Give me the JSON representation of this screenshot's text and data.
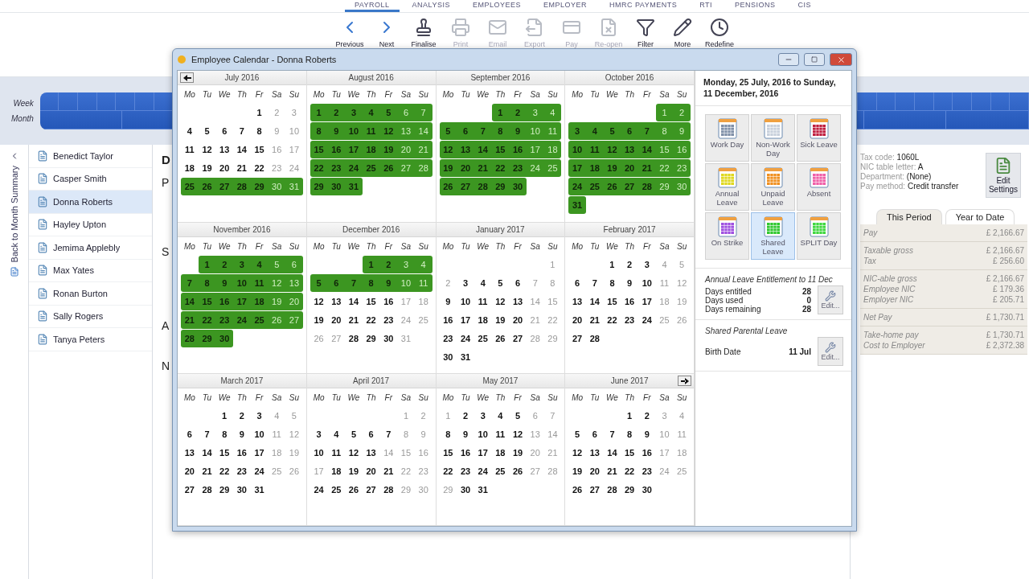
{
  "nav_tabs": [
    {
      "label": "PAYROLL",
      "selected": true
    },
    {
      "label": "ANALYSIS",
      "selected": false
    },
    {
      "label": "EMPLOYEES",
      "selected": false
    },
    {
      "label": "EMPLOYER",
      "selected": false
    },
    {
      "label": "HMRC PAYMENTS",
      "selected": false
    },
    {
      "label": "RTI",
      "selected": false
    },
    {
      "label": "PENSIONS",
      "selected": false
    },
    {
      "label": "CIS",
      "selected": false
    }
  ],
  "toolbar": [
    {
      "label": "Previous",
      "disabled": false
    },
    {
      "label": "Next",
      "disabled": false
    },
    {
      "label": "Finalise",
      "disabled": false
    },
    {
      "label": "Print",
      "disabled": true
    },
    {
      "label": "Email",
      "disabled": true
    },
    {
      "label": "Export",
      "disabled": true
    },
    {
      "label": "Pay",
      "disabled": true
    },
    {
      "label": "Re-open",
      "disabled": true
    },
    {
      "label": "Filter",
      "disabled": false
    },
    {
      "label": "More",
      "disabled": false
    },
    {
      "label": "Redefine",
      "disabled": false
    }
  ],
  "timeline": {
    "week_label": "Week",
    "month_label": "Month"
  },
  "back_link": "Back to Month Summary",
  "employees": [
    {
      "name": "Benedict Taylor",
      "selected": false
    },
    {
      "name": "Casper Smith",
      "selected": false
    },
    {
      "name": "Donna Roberts",
      "selected": true
    },
    {
      "name": "Hayley Upton",
      "selected": false
    },
    {
      "name": "Jemima Applebly",
      "selected": false
    },
    {
      "name": "Max Yates",
      "selected": false
    },
    {
      "name": "Ronan Burton",
      "selected": false
    },
    {
      "name": "Sally Rogers",
      "selected": false
    },
    {
      "name": "Tanya Peters",
      "selected": false
    }
  ],
  "content_fragments": [
    "D",
    "P",
    "S",
    "A",
    "N"
  ],
  "employee_info": [
    {
      "label": "Tax code:",
      "value": "1060L"
    },
    {
      "label": "NIC table letter:",
      "value": "A"
    },
    {
      "label": "Department:",
      "value": "(None)"
    },
    {
      "label": "Pay method:",
      "value": "Credit transfer"
    }
  ],
  "edit_settings": "Edit Settings",
  "summary_tabs": [
    {
      "label": "This Period",
      "selected": true
    },
    {
      "label": "Year to Date",
      "selected": false
    }
  ],
  "summary_groups": [
    [
      {
        "label": "Pay",
        "value": "£ 2,166.67"
      }
    ],
    [
      {
        "label": "Taxable gross",
        "value": "£ 2,166.67"
      },
      {
        "label": "Tax",
        "value": "£ 256.60"
      }
    ],
    [
      {
        "label": "NIC-able gross",
        "value": "£ 2,166.67"
      },
      {
        "label": "Employee NIC",
        "value": "£ 179.36"
      },
      {
        "label": "Employer NIC",
        "value": "£ 205.71"
      }
    ],
    [
      {
        "label": "Net Pay",
        "value": "£ 1,730.71"
      }
    ],
    [
      {
        "label": "Take-home pay",
        "value": "£ 1,730.71"
      },
      {
        "label": "Cost to Employer",
        "value": "£ 2,372.38"
      }
    ]
  ],
  "dialog": {
    "title": "Employee Calendar - Donna Roberts",
    "months": [
      {
        "title": "July 2016",
        "weekdays": [
          "Mo",
          "Tu",
          "We",
          "Th",
          "Fr",
          "Sa",
          "Su"
        ],
        "weeks": [
          {
            "days": [
              "1",
              "2",
              "3"
            ],
            "leave": false
          },
          {
            "days": [
              "4",
              "5",
              "6",
              "7",
              "8",
              "9",
              "10"
            ],
            "leave": false
          },
          {
            "days": [
              "11",
              "12",
              "13",
              "14",
              "15",
              "16",
              "17"
            ],
            "leave": false
          },
          {
            "days": [
              "18",
              "19",
              "20",
              "21",
              "22",
              "23",
              "24"
            ],
            "leave": false
          },
          {
            "days": [
              "25",
              "26",
              "27",
              "28",
              "29",
              "30",
              "31"
            ],
            "leave": true
          }
        ]
      },
      {
        "title": "August 2016",
        "weekdays": [
          "Mo",
          "Tu",
          "We",
          "Th",
          "Fr",
          "Sa",
          "Su"
        ],
        "weeks": [
          {
            "days": [
              "1",
              "2",
              "3",
              "4",
              "5",
              "6",
              "7"
            ],
            "leave": true
          },
          {
            "days": [
              "8",
              "9",
              "10",
              "11",
              "12",
              "13",
              "14"
            ],
            "leave": true
          },
          {
            "days": [
              "15",
              "16",
              "17",
              "18",
              "19",
              "20",
              "21"
            ],
            "leave": true
          },
          {
            "days": [
              "22",
              "23",
              "24",
              "25",
              "26",
              "27",
              "28"
            ],
            "leave": true
          },
          {
            "days": [
              "29",
              "30",
              "31"
            ],
            "leave": true
          }
        ]
      },
      {
        "title": "September 2016",
        "weekdays": [
          "Mo",
          "Tu",
          "We",
          "Th",
          "Fr",
          "Sa",
          "Su"
        ],
        "weeks": [
          {
            "days": [
              "1",
              "2",
              "3",
              "4"
            ],
            "leave": true
          },
          {
            "days": [
              "5",
              "6",
              "7",
              "8",
              "9",
              "10",
              "11"
            ],
            "leave": true
          },
          {
            "days": [
              "12",
              "13",
              "14",
              "15",
              "16",
              "17",
              "18"
            ],
            "leave": true
          },
          {
            "days": [
              "19",
              "20",
              "21",
              "22",
              "23",
              "24",
              "25"
            ],
            "leave": true
          },
          {
            "days": [
              "26",
              "27",
              "28",
              "29",
              "30"
            ],
            "leave": true
          }
        ]
      },
      {
        "title": "October 2016",
        "weekdays": [
          "Mo",
          "Tu",
          "We",
          "Th",
          "Fr",
          "Sa",
          "Su"
        ],
        "weeks": [
          {
            "days": [
              "1",
              "2"
            ],
            "leave": true
          },
          {
            "days": [
              "3",
              "4",
              "5",
              "6",
              "7",
              "8",
              "9"
            ],
            "leave": true
          },
          {
            "days": [
              "10",
              "11",
              "12",
              "13",
              "14",
              "15",
              "16"
            ],
            "leave": true
          },
          {
            "days": [
              "17",
              "18",
              "19",
              "20",
              "21",
              "22",
              "23"
            ],
            "leave": true
          },
          {
            "days": [
              "24",
              "25",
              "26",
              "27",
              "28",
              "29",
              "30"
            ],
            "leave": true
          },
          {
            "days": [
              "31"
            ],
            "leave": true
          }
        ]
      },
      {
        "title": "November 2016",
        "weekdays": [
          "Mo",
          "Tu",
          "We",
          "Th",
          "Fr",
          "Sa",
          "Su"
        ],
        "weeks": [
          {
            "days": [
              "1",
              "2",
              "3",
              "4",
              "5",
              "6"
            ],
            "leave": true
          },
          {
            "days": [
              "7",
              "8",
              "9",
              "10",
              "11",
              "12",
              "13"
            ],
            "leave": true
          },
          {
            "days": [
              "14",
              "15",
              "16",
              "17",
              "18",
              "19",
              "20"
            ],
            "leave": true
          },
          {
            "days": [
              "21",
              "22",
              "23",
              "24",
              "25",
              "26",
              "27"
            ],
            "leave": true
          },
          {
            "days": [
              "28",
              "29",
              "30"
            ],
            "leave": true
          }
        ]
      },
      {
        "title": "December 2016",
        "weekdays": [
          "Mo",
          "Tu",
          "We",
          "Th",
          "Fr",
          "Sa",
          "Su"
        ],
        "weeks": [
          {
            "days": [
              "1",
              "2",
              "3",
              "4"
            ],
            "leave": true
          },
          {
            "days": [
              "5",
              "6",
              "7",
              "8",
              "9",
              "10",
              "11"
            ],
            "leave": true
          },
          {
            "days": [
              "12",
              "13",
              "14",
              "15",
              "16",
              "17",
              "18"
            ],
            "leave": false
          },
          {
            "days": [
              "19",
              "20",
              "21",
              "22",
              "23",
              "24",
              "25"
            ],
            "leave": false
          },
          {
            "days": [
              {
                "day": "26",
                "off": true
              },
              {
                "day": "27",
                "off": true
              },
              "28",
              "29",
              "30",
              "31"
            ],
            "leave": false
          }
        ]
      },
      {
        "title": "January 2017",
        "weekdays": [
          "Mo",
          "Tu",
          "We",
          "Th",
          "Fr",
          "Sa",
          "Su"
        ],
        "weeks": [
          {
            "days": [
              "1"
            ],
            "leave": false
          },
          {
            "days": [
              {
                "day": "2",
                "off": true
              },
              "3",
              "4",
              "5",
              "6",
              "7",
              "8"
            ],
            "leave": false
          },
          {
            "days": [
              "9",
              "10",
              "11",
              "12",
              "13",
              "14",
              "15"
            ],
            "leave": false
          },
          {
            "days": [
              "16",
              "17",
              "18",
              "19",
              "20",
              "21",
              "22"
            ],
            "leave": false
          },
          {
            "days": [
              "23",
              "24",
              "25",
              "26",
              "27",
              "28",
              "29"
            ],
            "leave": false
          },
          {
            "days": [
              "30",
              "31"
            ],
            "leave": false
          }
        ]
      },
      {
        "title": "February 2017",
        "weekdays": [
          "Mo",
          "Tu",
          "We",
          "Th",
          "Fr",
          "Sa",
          "Su"
        ],
        "weeks": [
          {
            "days": [
              "1",
              "2",
              "3",
              "4",
              "5"
            ],
            "leave": false
          },
          {
            "days": [
              "6",
              "7",
              "8",
              "9",
              "10",
              "11",
              "12"
            ],
            "leave": false
          },
          {
            "days": [
              "13",
              "14",
              "15",
              "16",
              "17",
              "18",
              "19"
            ],
            "leave": false
          },
          {
            "days": [
              "20",
              "21",
              "22",
              "23",
              "24",
              "25",
              "26"
            ],
            "leave": false
          },
          {
            "days": [
              "27",
              "28"
            ],
            "leave": false
          }
        ]
      },
      {
        "title": "March 2017",
        "weekdays": [
          "Mo",
          "Tu",
          "We",
          "Th",
          "Fr",
          "Sa",
          "Su"
        ],
        "weeks": [
          {
            "days": [
              "1",
              "2",
              "3",
              "4",
              "5"
            ],
            "leave": false
          },
          {
            "days": [
              "6",
              "7",
              "8",
              "9",
              "10",
              "11",
              "12"
            ],
            "leave": false
          },
          {
            "days": [
              "13",
              "14",
              "15",
              "16",
              "17",
              "18",
              "19"
            ],
            "leave": false
          },
          {
            "days": [
              "20",
              "21",
              "22",
              "23",
              "24",
              "25",
              "26"
            ],
            "leave": false
          },
          {
            "days": [
              "27",
              "28",
              "29",
              "30",
              "31"
            ],
            "leave": false
          }
        ]
      },
      {
        "title": "April 2017",
        "weekdays": [
          "Mo",
          "Tu",
          "We",
          "Th",
          "Fr",
          "Sa",
          "Su"
        ],
        "weeks": [
          {
            "days": [
              "1",
              "2"
            ],
            "leave": false
          },
          {
            "days": [
              "3",
              "4",
              "5",
              "6",
              "7",
              "8",
              "9"
            ],
            "leave": false
          },
          {
            "days": [
              "10",
              "11",
              "12",
              "13",
              {
                "day": "14",
                "off": true
              },
              "15",
              "16"
            ],
            "leave": false
          },
          {
            "days": [
              {
                "day": "17",
                "off": true
              },
              "18",
              "19",
              "20",
              "21",
              "22",
              "23"
            ],
            "leave": false
          },
          {
            "days": [
              "24",
              "25",
              "26",
              "27",
              "28",
              "29",
              "30"
            ],
            "leave": false
          }
        ]
      },
      {
        "title": "May 2017",
        "weekdays": [
          "Mo",
          "Tu",
          "We",
          "Th",
          "Fr",
          "Sa",
          "Su"
        ],
        "weeks": [
          {
            "days": [
              {
                "day": "1",
                "off": true
              },
              "2",
              "3",
              "4",
              "5",
              "6",
              "7"
            ],
            "leave": false
          },
          {
            "days": [
              "8",
              "9",
              "10",
              "11",
              "12",
              "13",
              "14"
            ],
            "leave": false
          },
          {
            "days": [
              "15",
              "16",
              "17",
              "18",
              "19",
              "20",
              "21"
            ],
            "leave": false
          },
          {
            "days": [
              "22",
              "23",
              "24",
              "25",
              "26",
              "27",
              "28"
            ],
            "leave": false
          },
          {
            "days": [
              {
                "day": "29",
                "off": true
              },
              "30",
              "31"
            ],
            "leave": false
          }
        ]
      },
      {
        "title": "June 2017",
        "weekdays": [
          "Mo",
          "Tu",
          "We",
          "Th",
          "Fr",
          "Sa",
          "Su"
        ],
        "weeks": [
          {
            "days": [
              "1",
              "2",
              "3",
              "4"
            ],
            "leave": false
          },
          {
            "days": [
              "5",
              "6",
              "7",
              "8",
              "9",
              "10",
              "11"
            ],
            "leave": false
          },
          {
            "days": [
              "12",
              "13",
              "14",
              "15",
              "16",
              "17",
              "18"
            ],
            "leave": false
          },
          {
            "days": [
              "19",
              "20",
              "21",
              "22",
              "23",
              "24",
              "25"
            ],
            "leave": false
          },
          {
            "days": [
              "26",
              "27",
              "28",
              "29",
              "30"
            ],
            "leave": false
          }
        ]
      }
    ],
    "range": "Monday, 25 July, 2016 to Sunday, 11 December, 2016",
    "leave_types": [
      {
        "label": "Work Day",
        "color": "#8090a8",
        "selected": false
      },
      {
        "label": "Non-Work Day",
        "color": "#c8d0dc",
        "selected": false
      },
      {
        "label": "Sick Leave",
        "color": "#c02040",
        "selected": false
      },
      {
        "label": "Annual Leave",
        "color": "#e0d820",
        "selected": false
      },
      {
        "label": "Unpaid Leave",
        "color": "#f09020",
        "selected": false
      },
      {
        "label": "Absent",
        "color": "#f060a8",
        "selected": false
      },
      {
        "label": "On Strike",
        "color": "#a050e0",
        "selected": false
      },
      {
        "label": "Shared Leave",
        "color": "#30c830",
        "selected": true
      },
      {
        "label": "SPLIT Day",
        "color": "#40d840",
        "selected": false
      }
    ],
    "entitlement": {
      "title": "Annual Leave Entitlement to 11 Dec",
      "rows": [
        {
          "label": "Days entitled",
          "value": "28"
        },
        {
          "label": "Days used",
          "value": "0"
        },
        {
          "label": "Days remaining",
          "value": "28"
        }
      ],
      "button": "Edit..."
    },
    "shared_parental": {
      "title": "Shared Parental Leave",
      "rows": [
        {
          "label": "Birth Date",
          "value": "11 Jul"
        }
      ],
      "button": "Edit..."
    }
  }
}
